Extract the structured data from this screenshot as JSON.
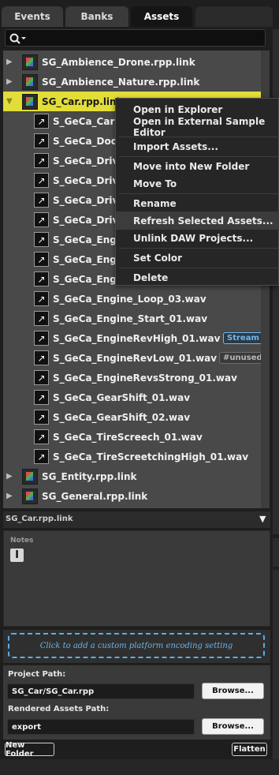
{
  "tabs": [
    {
      "label": "Events"
    },
    {
      "label": "Banks"
    },
    {
      "label": "Assets"
    }
  ],
  "active_tab": "Assets",
  "search": {
    "value": "",
    "icon": "search-icon"
  },
  "tree": {
    "rows": [
      {
        "label": "SG_Ambience_Drone.rpp.link",
        "kind": "project",
        "expanded": false
      },
      {
        "label": "SG_Ambience_Nature.rpp.link",
        "kind": "project",
        "expanded": false
      },
      {
        "label": "SG_Car.rpp.link",
        "kind": "project",
        "expanded": true,
        "selected": true
      },
      {
        "label": "S_GeCa_CarRe",
        "kind": "asset"
      },
      {
        "label": "S_GeCa_DoorO",
        "kind": "asset"
      },
      {
        "label": "S_GeCa_DriveI",
        "kind": "asset"
      },
      {
        "label": "S_GeCa_DriveI",
        "kind": "asset"
      },
      {
        "label": "S_GeCa_DriveI",
        "kind": "asset"
      },
      {
        "label": "S_GeCa_DriveI",
        "kind": "asset"
      },
      {
        "label": "S_GeCa_Engine",
        "kind": "asset"
      },
      {
        "label": "S_GeCa_Engine",
        "kind": "asset"
      },
      {
        "label": "S_GeCa_Engine",
        "kind": "asset"
      },
      {
        "label": "S_GeCa_Engine_Loop_03.wav",
        "kind": "asset"
      },
      {
        "label": "S_GeCa_Engine_Start_01.wav",
        "kind": "asset"
      },
      {
        "label": "S_GeCa_EngineRevHigh_01.wav",
        "kind": "asset",
        "tag": "Stream"
      },
      {
        "label": "S_GeCa_EngineRevLow_01.wav",
        "kind": "asset",
        "tag": "#unused"
      },
      {
        "label": "S_GeCa_EngineRevsStrong_01.wav",
        "kind": "asset"
      },
      {
        "label": "S_GeCa_GearShift_01.wav",
        "kind": "asset"
      },
      {
        "label": "S_GeCa_GearShift_02.wav",
        "kind": "asset"
      },
      {
        "label": "S_GeCa_TireScreech_01.wav",
        "kind": "asset"
      },
      {
        "label": "S_GeCa_TireScreetchingHigh_01.wav",
        "kind": "asset"
      },
      {
        "label": "SG_Entity.rpp.link",
        "kind": "project",
        "expanded": false
      },
      {
        "label": "SG_General.rpp.link",
        "kind": "project",
        "expanded": false
      }
    ]
  },
  "context_menu": {
    "items": [
      {
        "label": "Open in Explorer"
      },
      {
        "label": "Open in External Sample Editor"
      },
      {
        "label": "Import Assets..."
      },
      {
        "label": "Move into New Folder"
      },
      {
        "label": "Move To"
      },
      {
        "label": "Rename"
      },
      {
        "label": "Refresh Selected Assets...",
        "highlighted": true
      },
      {
        "label": "Unlink DAW Projects..."
      },
      {
        "label": "Set Color"
      },
      {
        "label": "Delete"
      }
    ]
  },
  "selection_bar": {
    "title": "SG_Car.rpp.link",
    "toggle_icon": "triangle-down-icon"
  },
  "notes": {
    "label": "Notes",
    "value": "",
    "cursor_icon": "text-cursor-icon"
  },
  "platform": {
    "placeholder": "Click to add a custom platform encoding setting"
  },
  "paths": {
    "project_label": "Project Path:",
    "project_value": "SG_Car/SG_Car.rpp",
    "rendered_label": "Rendered Assets Path:",
    "rendered_value": "export",
    "browse_label": "Browse..."
  },
  "footer": {
    "new_folder_label": "New Folder",
    "flatten_label": "Flatten"
  },
  "colors": {
    "selection": "#e3dd3a",
    "stream_tag": "#6fb8f0",
    "platform_dashed": "#5aaee0",
    "panel": "#494949"
  }
}
